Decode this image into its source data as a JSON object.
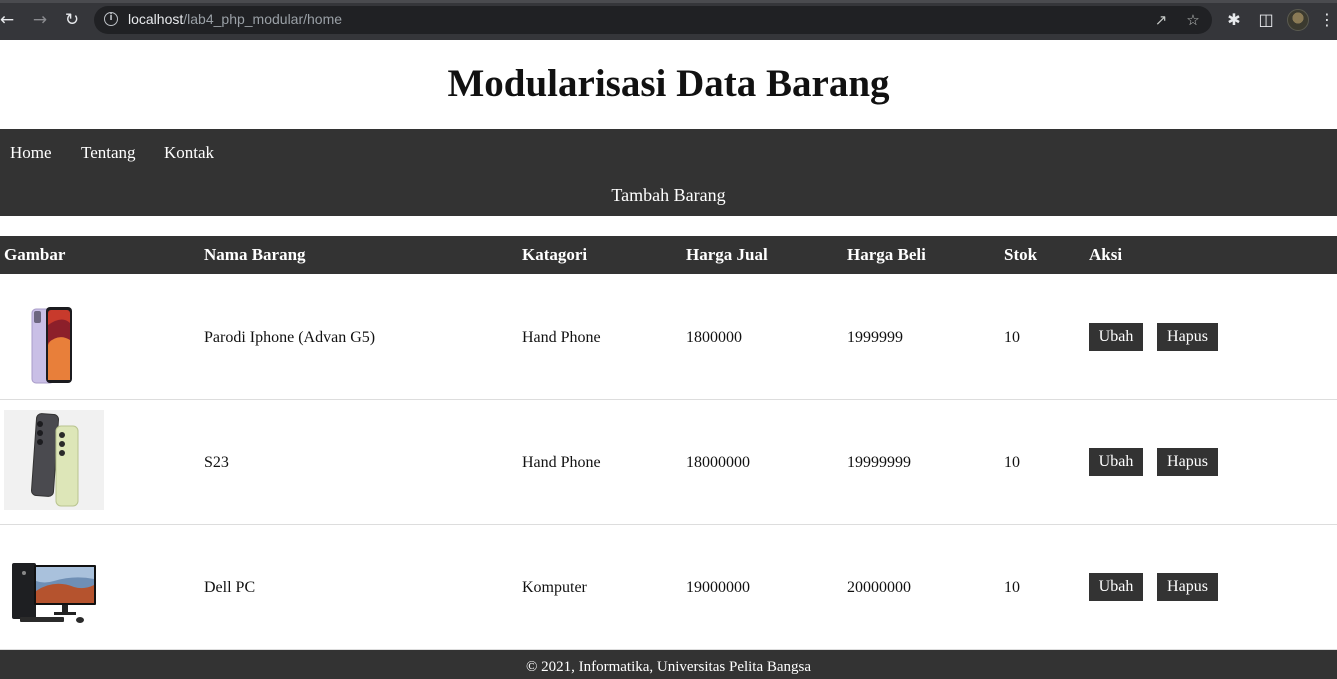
{
  "browser": {
    "url_host": "localhost",
    "url_path": "/lab4_php_modular/home",
    "icons": [
      "back-arrow-icon",
      "forward-arrow-icon",
      "reload-icon",
      "info-icon",
      "share-icon",
      "star-icon",
      "puzzle-icon",
      "side-panel-icon",
      "avatar",
      "kebab-menu-icon"
    ]
  },
  "page": {
    "title": "Modularisasi Data Barang"
  },
  "nav": {
    "items": [
      {
        "label": "Home"
      },
      {
        "label": "Tentang"
      },
      {
        "label": "Kontak"
      }
    ],
    "add_label": "Tambah Barang"
  },
  "table": {
    "headers": [
      "Gambar",
      "Nama Barang",
      "Katagori",
      "Harga Jual",
      "Harga Beli",
      "Stok",
      "Aksi"
    ],
    "rows": [
      {
        "image": "phone-image",
        "nama": "Parodi Iphone (Advan G5)",
        "kategori": "Hand Phone",
        "harga_jual": "1800000",
        "harga_beli": "1999999",
        "stok": "10",
        "edit_label": "Ubah",
        "delete_label": "Hapus"
      },
      {
        "image": "samsung-s23-image",
        "nama": "S23",
        "kategori": "Hand Phone",
        "harga_jual": "18000000",
        "harga_beli": "19999999",
        "stok": "10",
        "edit_label": "Ubah",
        "delete_label": "Hapus"
      },
      {
        "image": "dell-pc-image",
        "nama": "Dell PC",
        "kategori": "Komputer",
        "harga_jual": "19000000",
        "harga_beli": "20000000",
        "stok": "10",
        "edit_label": "Ubah",
        "delete_label": "Hapus"
      }
    ]
  },
  "footer": {
    "text": "© 2021, Informatika, Universitas Pelita Bangsa"
  },
  "colors": {
    "navbar_bg": "#333333",
    "browser_bg": "#35363a",
    "omnibox_bg": "#202124",
    "row_border": "#dddddd"
  }
}
